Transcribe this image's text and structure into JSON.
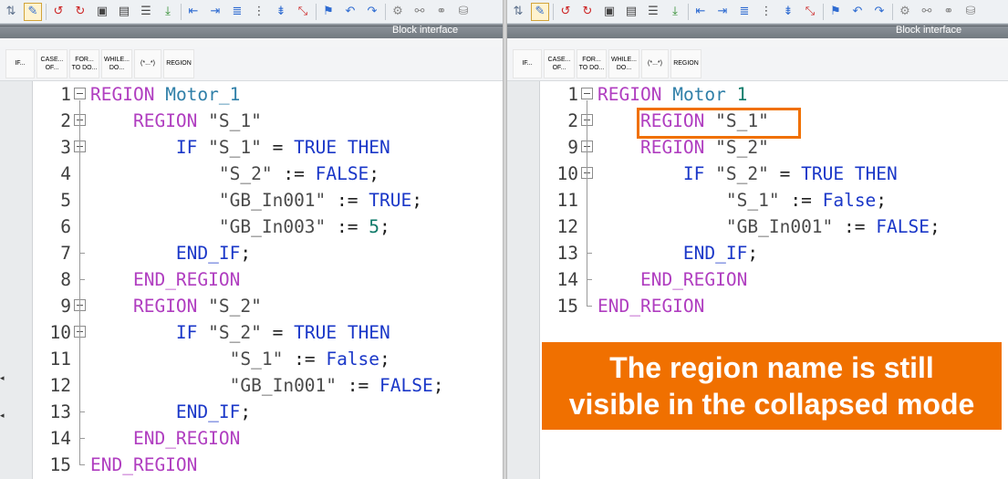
{
  "toolbar": {
    "icons": [
      "swap-icon",
      "watch-icon",
      "set-breakpoint-icon",
      "clear-breakpoint-icon",
      "snapshot-icon",
      "block-icon",
      "list-icon",
      "download-icon",
      "indent-less-icon",
      "indent-more-icon",
      "outdent-icon",
      "align-icon",
      "sort-icon",
      "remove-icon",
      "bookmark-icon",
      "undo-arrow-icon",
      "redo-arrow-icon",
      "monitor-icon",
      "compare-icon",
      "view-icon",
      "database-icon"
    ]
  },
  "left_pane": {
    "interface_label": "Block interface",
    "templates": [
      "IF...",
      "CASE...\nOF...",
      "FOR...\nTO DO...",
      "WHILE...\nDO...",
      "(*...*)",
      "REGION"
    ],
    "lines": [
      {
        "num": "1",
        "text": "REGION Motor_1"
      },
      {
        "num": "2",
        "text": "    REGION \"S_1\""
      },
      {
        "num": "3",
        "text": "        IF \"S_1\" = TRUE THEN"
      },
      {
        "num": "4",
        "text": "            \"S_2\" := FALSE;"
      },
      {
        "num": "5",
        "text": "            \"GB_In001\" := TRUE;"
      },
      {
        "num": "6",
        "text": "            \"GB_In003\" := 5;"
      },
      {
        "num": "7",
        "text": "        END_IF;"
      },
      {
        "num": "8",
        "text": "    END_REGION"
      },
      {
        "num": "9",
        "text": "    REGION \"S_2\""
      },
      {
        "num": "10",
        "text": "        IF \"S_2\" = TRUE THEN"
      },
      {
        "num": "11",
        "text": "             \"S_1\" := False;"
      },
      {
        "num": "12",
        "text": "             \"GB_In001\" := FALSE;"
      },
      {
        "num": "13",
        "text": "        END_IF;"
      },
      {
        "num": "14",
        "text": "    END_REGION"
      },
      {
        "num": "15",
        "text": "END_REGION"
      }
    ]
  },
  "right_pane": {
    "interface_label": "Block interface",
    "templates": [
      "IF...",
      "CASE...\nOF...",
      "FOR...\nTO DO...",
      "WHILE...\nDO...",
      "(*...*)",
      "REGION"
    ],
    "lines": [
      {
        "num": "1",
        "text": "REGION Motor 1"
      },
      {
        "num": "2",
        "text": "    REGION \"S_1\""
      },
      {
        "num": "9",
        "text": "    REGION \"S_2\""
      },
      {
        "num": "10",
        "text": "        IF \"S_2\" = TRUE THEN"
      },
      {
        "num": "11",
        "text": "            \"S_1\" := False;"
      },
      {
        "num": "12",
        "text": "            \"GB_In001\" := FALSE;"
      },
      {
        "num": "13",
        "text": "        END_IF;"
      },
      {
        "num": "14",
        "text": "    END_REGION"
      },
      {
        "num": "15",
        "text": "END_REGION"
      }
    ]
  },
  "callout": {
    "line1": "The region name is still",
    "line2": "visible in the collapsed mode"
  },
  "colors": {
    "keyword_region": "#b03ec0",
    "keyword": "#1a37c8",
    "identifier": "#2f7fa8",
    "callout": "#f07000"
  }
}
